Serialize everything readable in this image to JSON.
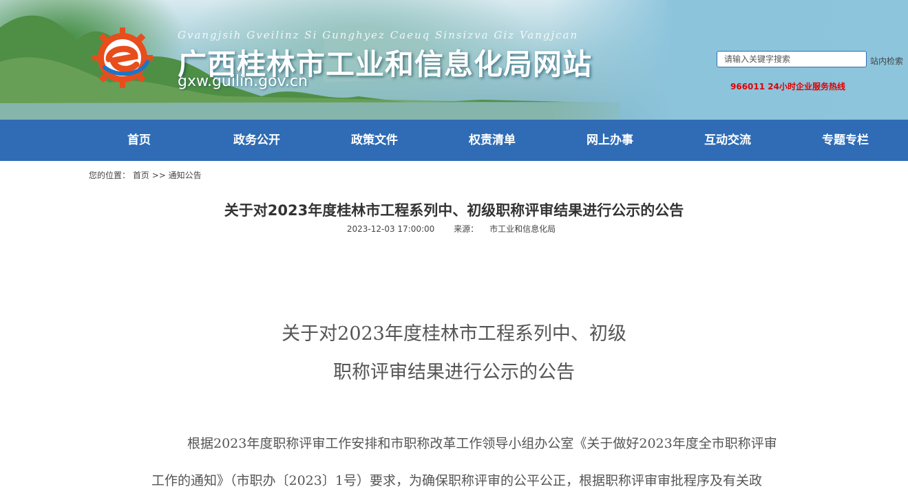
{
  "header": {
    "pinyin": "Gvangjsih Gveilinz Si Gunghyez Caeuq Sinsizva Giz Vangjcan",
    "site_title": "广西桂林市工业和信息化局网站",
    "domain": "gxw.guilin.gov.cn",
    "search_placeholder": "请输入关键字搜索",
    "search_button": "站内检索",
    "hotline": "966011 24小时企业服务热线"
  },
  "nav": [
    {
      "label": "首页"
    },
    {
      "label": "政务公开"
    },
    {
      "label": "政策文件"
    },
    {
      "label": "权责清单"
    },
    {
      "label": "网上办事"
    },
    {
      "label": "互动交流"
    },
    {
      "label": "专题专栏"
    }
  ],
  "breadcrumb": {
    "prefix": "您的位置：",
    "home": "首页",
    "sep": ">>",
    "current": "通知公告"
  },
  "article": {
    "title": "关于对2023年度桂林市工程系列中、初级职称评审结果进行公示的公告",
    "date": "2023-12-03 17:00:00",
    "source_label": "来源：",
    "source": "市工业和信息化局",
    "doc_title_line1": "关于对2023年度桂林市工程系列中、初级",
    "doc_title_line2": "职称评审结果进行公示的公告",
    "para_line1": "根据2023年度职称评审工作安排和市职称改革工作领导小组办公室《关于做好2023年度全市职称评审",
    "para_line2": "工作的通知》（市职办〔2023〕1号）要求，为确保职称评审的公平公正，根据职称评审审批程序及有关政"
  },
  "colors": {
    "nav_bg": "#2f6cb5",
    "hotline": "#e00000"
  }
}
